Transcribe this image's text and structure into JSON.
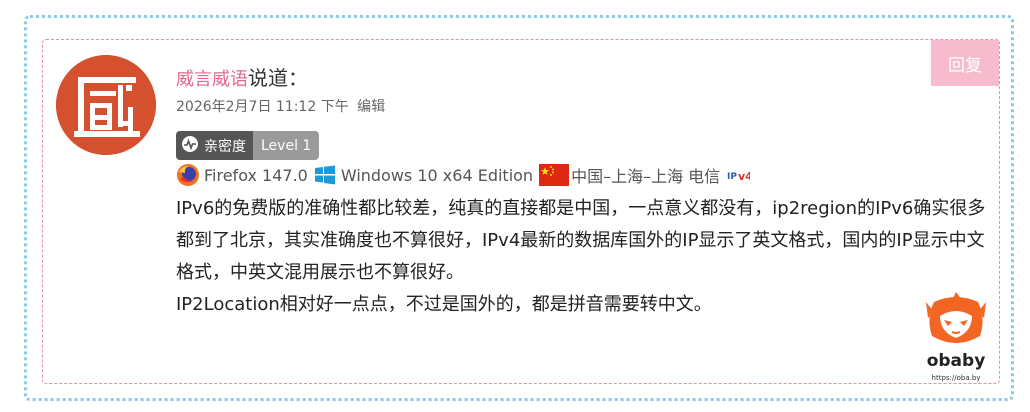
{
  "comment": {
    "author": "威言威语",
    "said": "说道：",
    "date": "2026年2月7日 11:12 下午",
    "edit_label": "编辑",
    "reply_label": "回复",
    "badge": {
      "label": "亲密度",
      "level": "Level 1"
    },
    "ua": {
      "browser": "Firefox 147.0",
      "os": "Windows 10 x64 Edition",
      "location": "中国–上海–上海 电信",
      "ip_badge": "IPv4"
    },
    "paragraphs": [
      "IPv6的免费版的准确性都比较差，纯真的直接都是中国，一点意义都没有，ip2region的IPv6确实很多都到了北京，其实准确度也不算很好，IPv4最新的数据库国外的IP显示了英文格式，国内的IP显示中文格式，中英文混用展示也不算很好。",
      "IP2Location相对好一点点，不过是国外的，都是拼音需要转中文。"
    ]
  },
  "watermark": {
    "brand": "obaby",
    "url": "https://oba.by"
  },
  "colors": {
    "outer_border": "#8ec9e8",
    "card_border": "#e58fae",
    "author": "#e06a8c",
    "reply_bg": "#f6bccd",
    "avatar_bg": "#d5502e"
  }
}
